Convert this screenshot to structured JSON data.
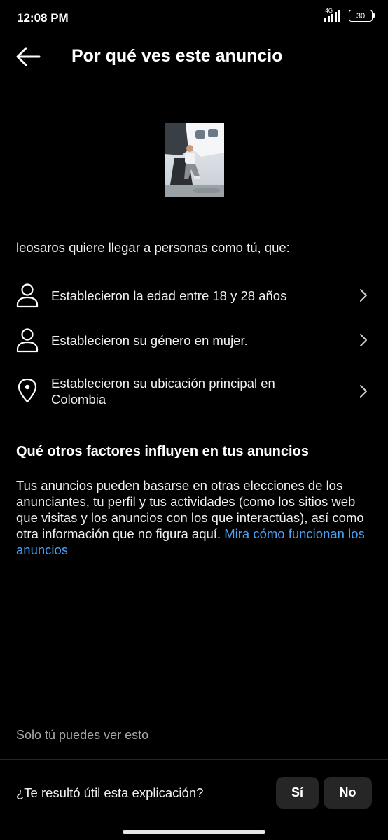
{
  "status_bar": {
    "time": "12:08 PM",
    "network": "4G",
    "battery": "30"
  },
  "header": {
    "title": "Por qué ves este anuncio",
    "back_icon": "arrow-left-icon"
  },
  "ad": {
    "thumbnail_icon": "ad-photo"
  },
  "targeting": {
    "intro": "leosaros quiere llegar a personas como tú, que:",
    "items": [
      {
        "icon": "person-icon",
        "label": "Establecieron la edad entre 18 y 28 años"
      },
      {
        "icon": "person-icon",
        "label": "Establecieron su género en mujer."
      },
      {
        "icon": "location-pin-icon",
        "label": "Establecieron su ubicación principal en Colombia"
      }
    ]
  },
  "other_factors": {
    "title": "Qué otros factores influyen en tus anuncios",
    "body": "Tus anuncios pueden basarse en otras elecciones de los anunciantes, tu perfil y tus actividades (como los sitios web que visitas y los anuncios con los que interactúas), así como otra información que no figura aquí.",
    "link_text": "Mira cómo funcionan los anuncios"
  },
  "footer": {
    "private_note": "Solo tú puedes ver esto",
    "feedback_question": "¿Te resultó útil esta explicación?",
    "yes_label": "Sí",
    "no_label": "No"
  },
  "colors": {
    "background": "#000000",
    "link": "#4aa0f2",
    "button_bg": "#262626"
  }
}
